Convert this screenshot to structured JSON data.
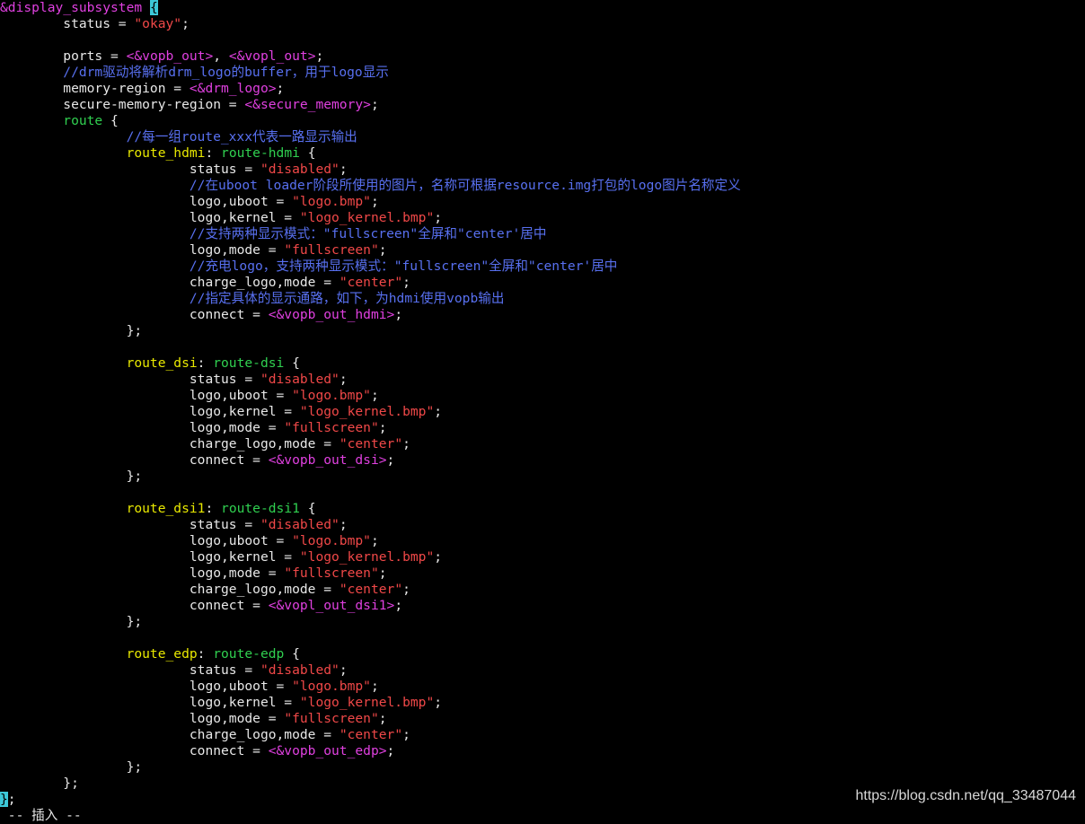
{
  "editor": {
    "lines": [
      [
        {
          "t": "&display_subsystem ",
          "c": "node"
        },
        {
          "t": "{",
          "c": "cursorbrace"
        }
      ],
      [
        {
          "t": "        status = ",
          "c": "plain"
        },
        {
          "t": "\"okay\"",
          "c": "str"
        },
        {
          "t": ";",
          "c": "plain"
        }
      ],
      [],
      [
        {
          "t": "        ports = ",
          "c": "plain"
        },
        {
          "t": "<&vopb_out>",
          "c": "ref"
        },
        {
          "t": ", ",
          "c": "plain"
        },
        {
          "t": "<&vopl_out>",
          "c": "ref"
        },
        {
          "t": ";",
          "c": "plain"
        }
      ],
      [
        {
          "t": "        //drm驱动将解析drm_logo的buffer，用于logo显示",
          "c": "comment"
        }
      ],
      [
        {
          "t": "        memory-region = ",
          "c": "plain"
        },
        {
          "t": "<&drm_logo>",
          "c": "ref"
        },
        {
          "t": ";",
          "c": "plain"
        }
      ],
      [
        {
          "t": "        secure-memory-region = ",
          "c": "plain"
        },
        {
          "t": "<&secure_memory>",
          "c": "ref"
        },
        {
          "t": ";",
          "c": "plain"
        }
      ],
      [
        {
          "t": "        route",
          "c": "keyword"
        },
        {
          "t": " {",
          "c": "plain"
        }
      ],
      [
        {
          "t": "                //每一组route_xxx代表一路显示输出",
          "c": "comment"
        }
      ],
      [
        {
          "t": "                route_hdmi",
          "c": "label"
        },
        {
          "t": ": ",
          "c": "plain"
        },
        {
          "t": "route-hdmi",
          "c": "compat"
        },
        {
          "t": " {",
          "c": "plain"
        }
      ],
      [
        {
          "t": "                        status = ",
          "c": "plain"
        },
        {
          "t": "\"disabled\"",
          "c": "str"
        },
        {
          "t": ";",
          "c": "plain"
        }
      ],
      [
        {
          "t": "                        //在uboot loader阶段所使用的图片，名称可根据resource.img打包的logo图片名称定义",
          "c": "comment"
        }
      ],
      [
        {
          "t": "                        logo,uboot = ",
          "c": "plain"
        },
        {
          "t": "\"logo.bmp\"",
          "c": "str"
        },
        {
          "t": ";",
          "c": "plain"
        }
      ],
      [
        {
          "t": "                        logo,kernel = ",
          "c": "plain"
        },
        {
          "t": "\"logo_kernel.bmp\"",
          "c": "str"
        },
        {
          "t": ";",
          "c": "plain"
        }
      ],
      [
        {
          "t": "                        //支持两种显示模式：\"fullscreen\"全屏和\"center'居中",
          "c": "comment"
        }
      ],
      [
        {
          "t": "                        logo,mode = ",
          "c": "plain"
        },
        {
          "t": "\"fullscreen\"",
          "c": "str"
        },
        {
          "t": ";",
          "c": "plain"
        }
      ],
      [
        {
          "t": "                        //充电logo，支持两种显示模式：\"fullscreen\"全屏和\"center'居中",
          "c": "comment"
        }
      ],
      [
        {
          "t": "                        charge_logo,mode = ",
          "c": "plain"
        },
        {
          "t": "\"center\"",
          "c": "str"
        },
        {
          "t": ";",
          "c": "plain"
        }
      ],
      [
        {
          "t": "                        //指定具体的显示通路，如下，为hdmi使用vopb输出",
          "c": "comment"
        }
      ],
      [
        {
          "t": "                        connect = ",
          "c": "plain"
        },
        {
          "t": "<&vopb_out_hdmi>",
          "c": "ref"
        },
        {
          "t": ";",
          "c": "plain"
        }
      ],
      [
        {
          "t": "                };",
          "c": "plain"
        }
      ],
      [],
      [
        {
          "t": "                route_dsi",
          "c": "label"
        },
        {
          "t": ": ",
          "c": "plain"
        },
        {
          "t": "route-dsi",
          "c": "compat"
        },
        {
          "t": " {",
          "c": "plain"
        }
      ],
      [
        {
          "t": "                        status = ",
          "c": "plain"
        },
        {
          "t": "\"disabled\"",
          "c": "str"
        },
        {
          "t": ";",
          "c": "plain"
        }
      ],
      [
        {
          "t": "                        logo,uboot = ",
          "c": "plain"
        },
        {
          "t": "\"logo.bmp\"",
          "c": "str"
        },
        {
          "t": ";",
          "c": "plain"
        }
      ],
      [
        {
          "t": "                        logo,kernel = ",
          "c": "plain"
        },
        {
          "t": "\"logo_kernel.bmp\"",
          "c": "str"
        },
        {
          "t": ";",
          "c": "plain"
        }
      ],
      [
        {
          "t": "                        logo,mode = ",
          "c": "plain"
        },
        {
          "t": "\"fullscreen\"",
          "c": "str"
        },
        {
          "t": ";",
          "c": "plain"
        }
      ],
      [
        {
          "t": "                        charge_logo,mode = ",
          "c": "plain"
        },
        {
          "t": "\"center\"",
          "c": "str"
        },
        {
          "t": ";",
          "c": "plain"
        }
      ],
      [
        {
          "t": "                        connect = ",
          "c": "plain"
        },
        {
          "t": "<&vopb_out_dsi>",
          "c": "ref"
        },
        {
          "t": ";",
          "c": "plain"
        }
      ],
      [
        {
          "t": "                };",
          "c": "plain"
        }
      ],
      [],
      [
        {
          "t": "                route_dsi1",
          "c": "label"
        },
        {
          "t": ": ",
          "c": "plain"
        },
        {
          "t": "route-dsi1",
          "c": "compat"
        },
        {
          "t": " {",
          "c": "plain"
        }
      ],
      [
        {
          "t": "                        status = ",
          "c": "plain"
        },
        {
          "t": "\"disabled\"",
          "c": "str"
        },
        {
          "t": ";",
          "c": "plain"
        }
      ],
      [
        {
          "t": "                        logo,uboot = ",
          "c": "plain"
        },
        {
          "t": "\"logo.bmp\"",
          "c": "str"
        },
        {
          "t": ";",
          "c": "plain"
        }
      ],
      [
        {
          "t": "                        logo,kernel = ",
          "c": "plain"
        },
        {
          "t": "\"logo_kernel.bmp\"",
          "c": "str"
        },
        {
          "t": ";",
          "c": "plain"
        }
      ],
      [
        {
          "t": "                        logo,mode = ",
          "c": "plain"
        },
        {
          "t": "\"fullscreen\"",
          "c": "str"
        },
        {
          "t": ";",
          "c": "plain"
        }
      ],
      [
        {
          "t": "                        charge_logo,mode = ",
          "c": "plain"
        },
        {
          "t": "\"center\"",
          "c": "str"
        },
        {
          "t": ";",
          "c": "plain"
        }
      ],
      [
        {
          "t": "                        connect = ",
          "c": "plain"
        },
        {
          "t": "<&vopl_out_dsi1>",
          "c": "ref"
        },
        {
          "t": ";",
          "c": "plain"
        }
      ],
      [
        {
          "t": "                };",
          "c": "plain"
        }
      ],
      [],
      [
        {
          "t": "                route_edp",
          "c": "label"
        },
        {
          "t": ": ",
          "c": "plain"
        },
        {
          "t": "route-edp",
          "c": "compat"
        },
        {
          "t": " {",
          "c": "plain"
        }
      ],
      [
        {
          "t": "                        status = ",
          "c": "plain"
        },
        {
          "t": "\"disabled\"",
          "c": "str"
        },
        {
          "t": ";",
          "c": "plain"
        }
      ],
      [
        {
          "t": "                        logo,uboot = ",
          "c": "plain"
        },
        {
          "t": "\"logo.bmp\"",
          "c": "str"
        },
        {
          "t": ";",
          "c": "plain"
        }
      ],
      [
        {
          "t": "                        logo,kernel = ",
          "c": "plain"
        },
        {
          "t": "\"logo_kernel.bmp\"",
          "c": "str"
        },
        {
          "t": ";",
          "c": "plain"
        }
      ],
      [
        {
          "t": "                        logo,mode = ",
          "c": "plain"
        },
        {
          "t": "\"fullscreen\"",
          "c": "str"
        },
        {
          "t": ";",
          "c": "plain"
        }
      ],
      [
        {
          "t": "                        charge_logo,mode = ",
          "c": "plain"
        },
        {
          "t": "\"center\"",
          "c": "str"
        },
        {
          "t": ";",
          "c": "plain"
        }
      ],
      [
        {
          "t": "                        connect = ",
          "c": "plain"
        },
        {
          "t": "<&vopb_out_edp>",
          "c": "ref"
        },
        {
          "t": ";",
          "c": "plain"
        }
      ],
      [
        {
          "t": "                };",
          "c": "plain"
        }
      ],
      [
        {
          "t": "        };",
          "c": "plain"
        }
      ],
      [
        {
          "t": "}",
          "c": "cursor"
        },
        {
          "t": ";",
          "c": "plain"
        }
      ]
    ],
    "status_line": " -- 插入 --"
  },
  "watermark": "https://blog.csdn.net/qq_33487044",
  "colors": {
    "background": "#000000",
    "plain": "#e8e8e8",
    "node": "#e040e0",
    "label": "#e8e800",
    "compat": "#30d050",
    "string": "#f04848",
    "comment": "#5870f0",
    "cursor": "#3cc8d8"
  }
}
